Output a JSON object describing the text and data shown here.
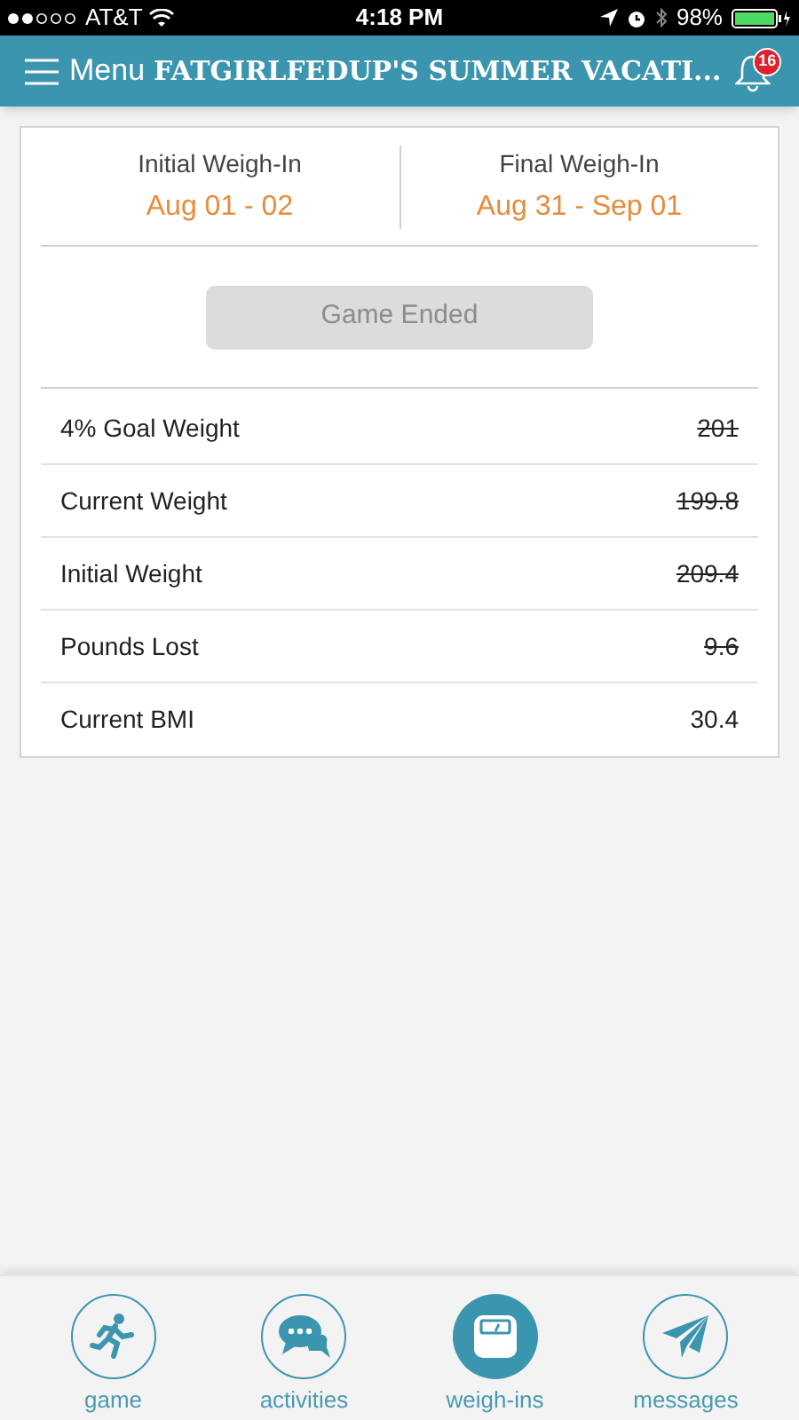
{
  "status_bar": {
    "carrier": "AT&T",
    "time": "4:18 PM",
    "battery": "98%"
  },
  "header": {
    "menu_label": "Menu",
    "title": "FATGIRLFEDUP'S SUMMER VACATI...",
    "notification_count": "16"
  },
  "weigh_ins": [
    {
      "label": "Initial Weigh-In",
      "dates": "Aug 01 - 02"
    },
    {
      "label": "Final Weigh-In",
      "dates": "Aug 31 - Sep 01"
    }
  ],
  "game_button": {
    "label": "Game Ended",
    "disabled": true
  },
  "stats": [
    {
      "label": "4% Goal Weight",
      "value": "201",
      "struck": true
    },
    {
      "label": "Current Weight",
      "value": "199.8",
      "struck": true
    },
    {
      "label": "Initial Weight",
      "value": "209.4",
      "struck": true
    },
    {
      "label": "Pounds Lost",
      "value": "9.6",
      "struck": true
    },
    {
      "label": "Current BMI",
      "value": "30.4",
      "struck": false
    }
  ],
  "tab_bar": [
    {
      "kind": "game",
      "label": "game",
      "selected": false
    },
    {
      "kind": "activities",
      "label": "activities",
      "selected": false
    },
    {
      "kind": "weighins",
      "label": "weigh-ins",
      "selected": true
    },
    {
      "kind": "messages",
      "label": "messages",
      "selected": false
    }
  ]
}
